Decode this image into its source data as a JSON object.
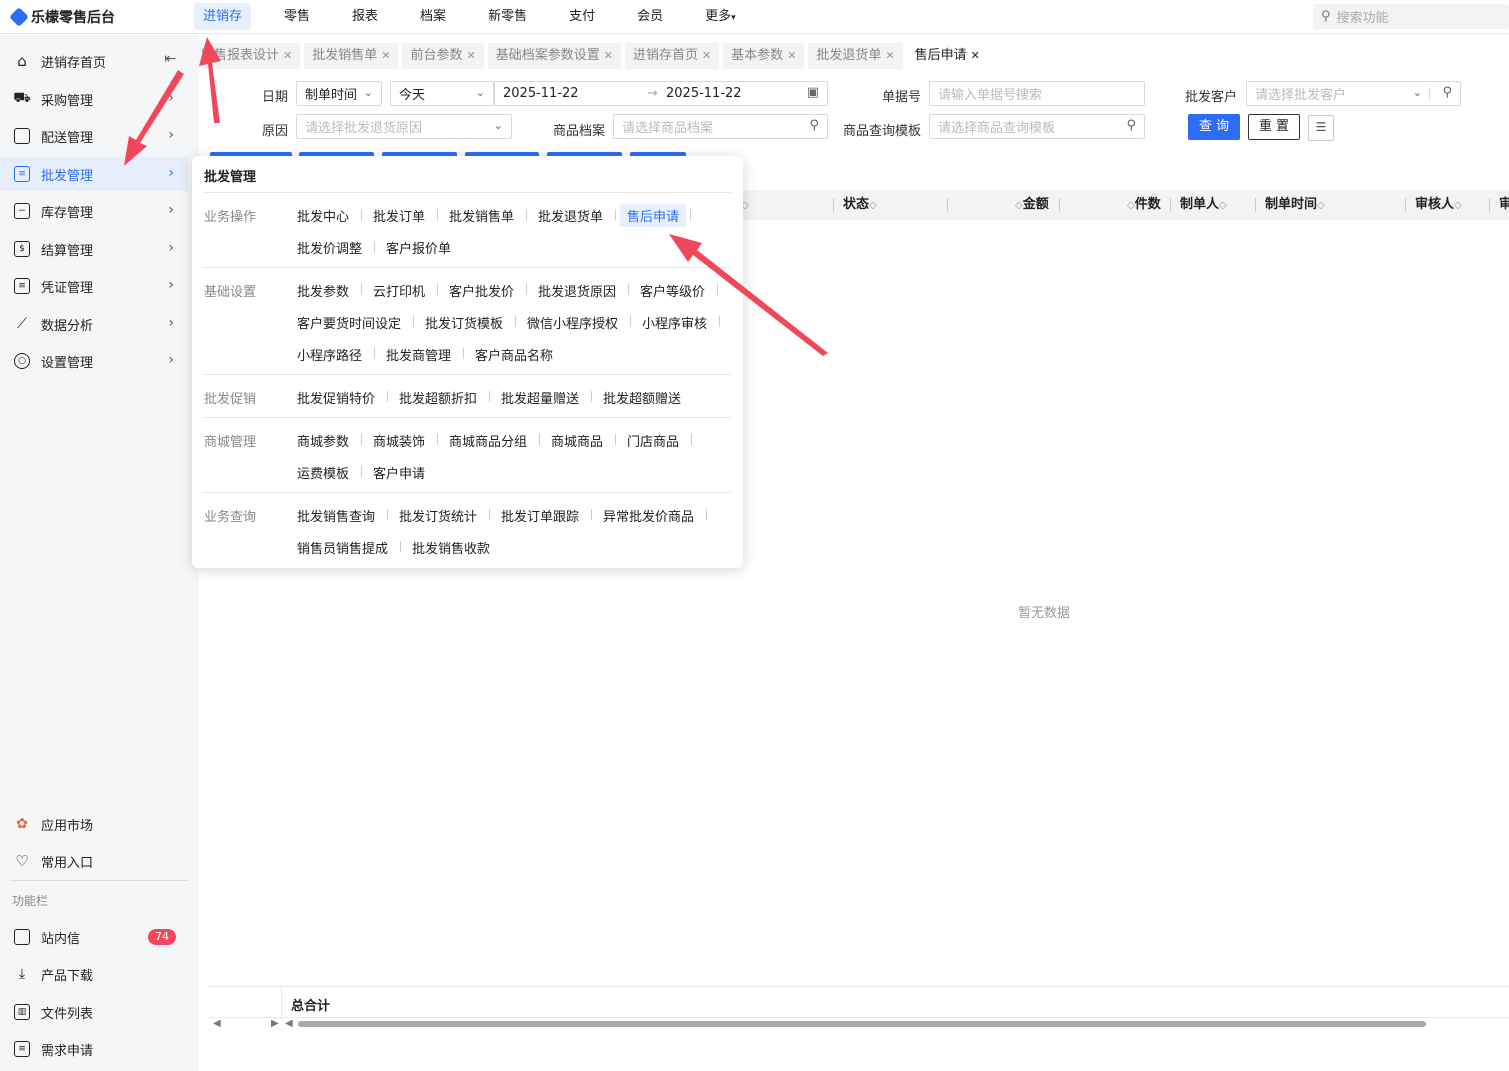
{
  "app": {
    "title": "乐檬零售后台"
  },
  "topnav": [
    {
      "label": "进销存",
      "active": true
    },
    {
      "label": "零售"
    },
    {
      "label": "报表"
    },
    {
      "label": "档案"
    },
    {
      "label": "新零售"
    },
    {
      "label": "支付"
    },
    {
      "label": "会员"
    },
    {
      "label": "更多"
    }
  ],
  "search": {
    "placeholder": "搜索功能"
  },
  "sidebar": {
    "items": [
      {
        "label": "进销存首页"
      },
      {
        "label": "采购管理"
      },
      {
        "label": "配送管理"
      },
      {
        "label": "批发管理",
        "active": true
      },
      {
        "label": "库存管理"
      },
      {
        "label": "结算管理"
      },
      {
        "label": "凭证管理"
      },
      {
        "label": "数据分析"
      },
      {
        "label": "设置管理"
      }
    ],
    "bottom": [
      {
        "label": "应用市场"
      },
      {
        "label": "常用入口"
      }
    ],
    "section": "功能栏",
    "tools": [
      {
        "label": "站内信",
        "badge": "74"
      },
      {
        "label": "产品下载"
      },
      {
        "label": "文件列表"
      },
      {
        "label": "需求申请"
      }
    ]
  },
  "tabs": [
    {
      "label": "零售报表设计"
    },
    {
      "label": "批发销售单"
    },
    {
      "label": "前台参数"
    },
    {
      "label": "基础档案参数设置"
    },
    {
      "label": "进销存首页"
    },
    {
      "label": "基本参数"
    },
    {
      "label": "批发退货单"
    },
    {
      "label": "售后申请",
      "active": true
    }
  ],
  "filters": {
    "date_label": "日期",
    "date_type": "制单时间",
    "date_range": "今天",
    "date_from": "2025-11-22",
    "date_to": "2025-11-22",
    "doc_no_label": "单据号",
    "doc_no_placeholder": "请输入单据号搜索",
    "customer_label": "批发客户",
    "customer_placeholder": "请选择批发客户",
    "reason_label": "原因",
    "reason_placeholder": "请选择批发退货原因",
    "goods_label": "商品档案",
    "goods_placeholder": "请选择商品档案",
    "template_label": "商品查询模板",
    "template_placeholder": "请选择商品查询模板",
    "query_btn": "查 询",
    "reset_btn": "重 置"
  },
  "table": {
    "columns": [
      "状态",
      "金额",
      "件数",
      "制单人",
      "制单时间",
      "审核人",
      "审"
    ],
    "empty_text": "暂无数据",
    "total_label": "总合计"
  },
  "dropdown": {
    "title": "批发管理",
    "groups": [
      {
        "category": "业务操作",
        "rows": [
          [
            "批发中心",
            "批发订单",
            "批发销售单",
            "批发退货单",
            "售后申请"
          ],
          [
            "批发价调整",
            "客户报价单"
          ]
        ]
      },
      {
        "category": "基础设置",
        "rows": [
          [
            "批发参数",
            "云打印机",
            "客户批发价",
            "批发退货原因",
            "客户等级价"
          ],
          [
            "客户要货时间设定",
            "批发订货模板",
            "微信小程序授权",
            "小程序审核"
          ],
          [
            "小程序路径",
            "批发商管理",
            "客户商品名称"
          ]
        ]
      },
      {
        "category": "批发促销",
        "rows": [
          [
            "批发促销特价",
            "批发超额折扣",
            "批发超量赠送",
            "批发超额赠送"
          ]
        ]
      },
      {
        "category": "商城管理",
        "rows": [
          [
            "商城参数",
            "商城装饰",
            "商城商品分组",
            "商城商品",
            "门店商品"
          ],
          [
            "运费模板",
            "客户申请"
          ]
        ]
      },
      {
        "category": "业务查询",
        "rows": [
          [
            "批发销售查询",
            "批发订货统计",
            "批发订单跟踪",
            "异常批发价商品"
          ],
          [
            "销售员销售提成",
            "批发销售收款"
          ]
        ]
      }
    ],
    "selected": "售后申请"
  },
  "colors": {
    "accent": "#2d6cf5",
    "annotation_arrow": "#f0485a",
    "badge": "#f5475b"
  }
}
